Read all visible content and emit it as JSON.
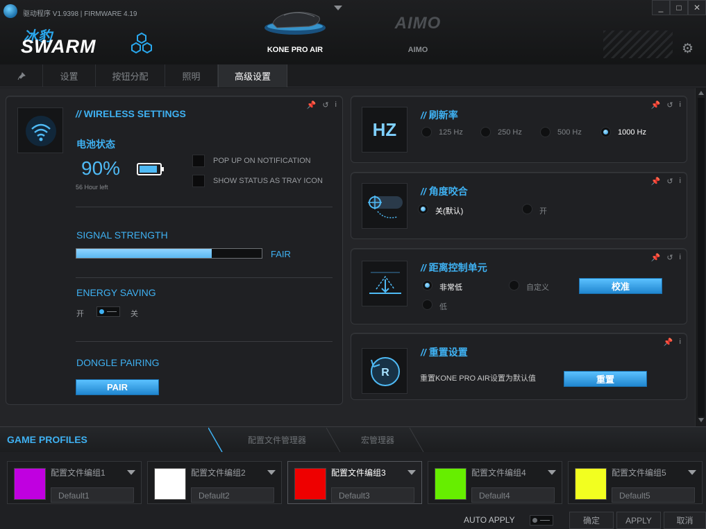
{
  "app": {
    "version_text": "驱动程序 V1.9398 | FIRMWARE 4.19",
    "brand_cn": "冰豹",
    "brand_name": "SWARM",
    "window_buttons": [
      "_",
      "□",
      "✕"
    ]
  },
  "devices": [
    {
      "label": "KONE PRO AIR",
      "active": true
    },
    {
      "label": "AIMO",
      "logo": "AIMO",
      "active": false
    }
  ],
  "tabs": [
    "设置",
    "按钮分配",
    "照明",
    "高级设置"
  ],
  "active_tab": "高级设置",
  "wireless": {
    "title": "WIRELESS SETTINGS",
    "battery_title": "电池状态",
    "battery_percent": "90%",
    "battery_level": 0.9,
    "hours_left": "56 Hour left",
    "popup_label": "POP UP ON NOTIFICATION",
    "tray_label": "SHOW STATUS AS TRAY ICON",
    "signal_title": "SIGNAL STRENGTH",
    "signal_level": 0.73,
    "signal_text": "FAIR",
    "energy_title": "ENERGY SAVING",
    "energy_on": "开",
    "energy_off": "关",
    "dongle_title": "DONGLE PAIRING",
    "pair_button": "PAIR"
  },
  "polling": {
    "title": "刷新率",
    "icon_text": "HZ",
    "options": [
      "125 Hz",
      "250 Hz",
      "500 Hz",
      "1000 Hz"
    ],
    "selected": "1000 Hz"
  },
  "angle_snapping": {
    "title": "角度咬合",
    "off_label": "关(默认)",
    "on_label": "开",
    "selected": "关(默认)"
  },
  "lod": {
    "title": "距离控制单元",
    "opt_very_low": "非常低",
    "opt_custom": "自定义",
    "opt_low": "低",
    "selected": "非常低",
    "calibrate_button": "校准"
  },
  "reset": {
    "title": "重置设置",
    "description": "重置KONE PRO AIR设置为默认值",
    "reset_button": "重置"
  },
  "profiles_bar": {
    "title": "GAME PROFILES",
    "tab_profile_manager": "配置文件管理器",
    "tab_macro_manager": "宏管理器"
  },
  "profiles": [
    {
      "name": "配置文件编组1",
      "default": "Default1",
      "color": "#c000e0",
      "active": false
    },
    {
      "name": "配置文件编组2",
      "default": "Default2",
      "color": "#ffffff",
      "active": false
    },
    {
      "name": "配置文件编组3",
      "default": "Default3",
      "color": "#ee0000",
      "active": true
    },
    {
      "name": "配置文件编组4",
      "default": "Default4",
      "color": "#66ee00",
      "active": false
    },
    {
      "name": "配置文件编组5",
      "default": "Default5",
      "color": "#f2ff20",
      "active": false
    }
  ],
  "footer": {
    "auto_apply": "AUTO APPLY",
    "ok": "确定",
    "apply": "APPLY",
    "cancel": "取消"
  },
  "accent_color": "#3fb1f2"
}
